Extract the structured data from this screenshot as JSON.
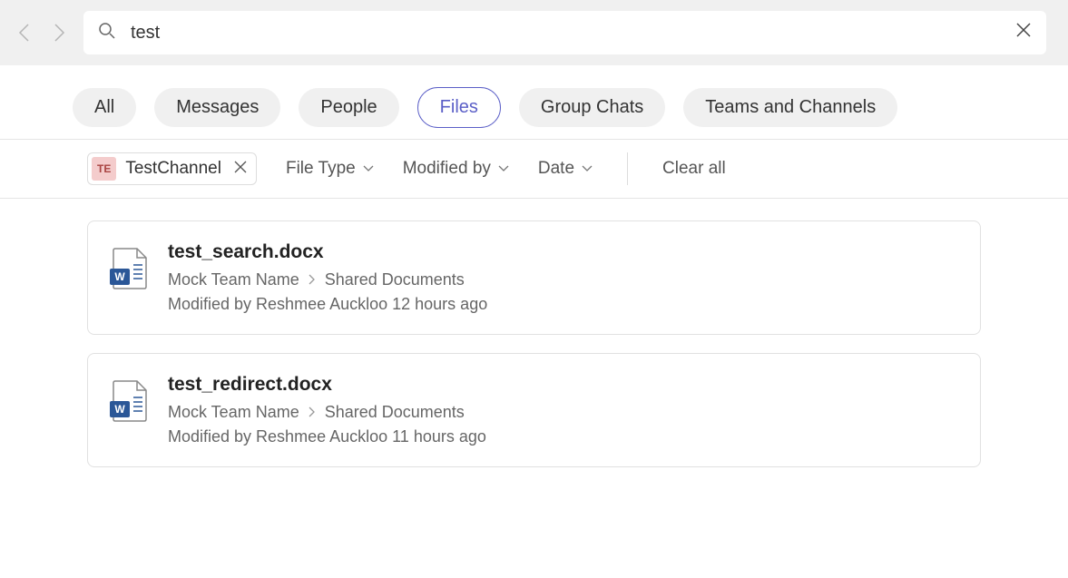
{
  "search": {
    "value": "test"
  },
  "tabs": [
    {
      "label": "All",
      "active": false
    },
    {
      "label": "Messages",
      "active": false
    },
    {
      "label": "People",
      "active": false
    },
    {
      "label": "Files",
      "active": true
    },
    {
      "label": "Group Chats",
      "active": false
    },
    {
      "label": "Teams and Channels",
      "active": false
    }
  ],
  "channelChip": {
    "badge": "TE",
    "label": "TestChannel"
  },
  "filters": {
    "fileType": "File Type",
    "modifiedBy": "Modified by",
    "date": "Date",
    "clearAll": "Clear all"
  },
  "results": [
    {
      "title": "test_search.docx",
      "team": "Mock Team Name",
      "location": "Shared Documents",
      "meta": "Modified by Reshmee Auckloo 12 hours ago"
    },
    {
      "title": "test_redirect.docx",
      "team": "Mock Team Name",
      "location": "Shared Documents",
      "meta": "Modified by Reshmee Auckloo 11 hours ago"
    }
  ]
}
